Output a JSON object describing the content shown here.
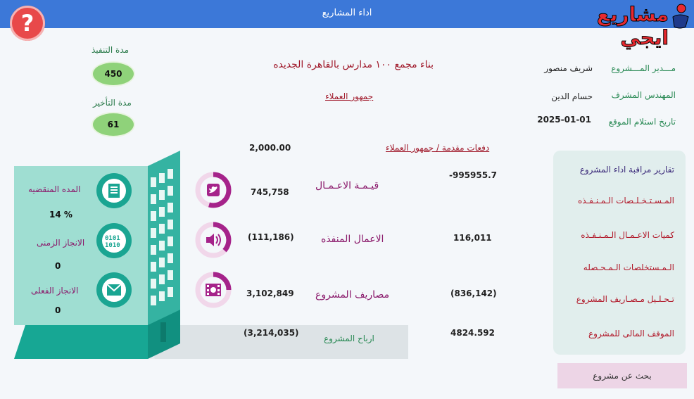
{
  "window": {
    "title": "اداء المشاريع"
  },
  "help_icon": {
    "glyph": "?"
  },
  "logo": {
    "text": "مشاريع ايجي"
  },
  "project": {
    "title": "بناء مجمع ١٠٠ مدارس بالقاهرة الجديده",
    "client_link": "جمهور العملاء",
    "payments_link": "دفعات مقدمة / جمهور العملاء",
    "payments_value": "2,000.00"
  },
  "info": {
    "manager_label": "مـــدير المـــشروع",
    "manager_value": "شريف منصور",
    "engineer_label": "المهندس المشرف",
    "engineer_value": "حسام الدين",
    "site_date_label": "تاريخ استلام الموقع",
    "site_date_value": "2025-01-01"
  },
  "durations": {
    "exec_label": "مدة التنفيذ",
    "exec_value": "450",
    "delay_label": "مدة التأخير",
    "delay_value": "61"
  },
  "metrics": {
    "works_value_label": "قيـمـة الاعـمـال",
    "works_value": "745,758",
    "works_right_value": "-995955.7",
    "executed_label": "الاعمال المنفذه",
    "executed_value": "(111,186)",
    "executed_right_value": "116,011",
    "expenses_label": "مصاريف المشروع",
    "expenses_value": "3,102,849",
    "expenses_right_value": "(836,142)",
    "profit_label": "ارباح المشروع",
    "profit_value": "(3,214,035)",
    "profit_right_value": "4824.592"
  },
  "progress": {
    "elapsed_label": "المده المنقضيه",
    "elapsed_value": "14 %",
    "time_label": "الانجاز الزمنى",
    "time_value": "0",
    "actual_label": "الانجاز الفعلى",
    "actual_value": "0"
  },
  "menu": [
    "تقارير مراقبة اداء المشروع",
    "المـسـتـخـلـصات الـمـنـفـذه",
    "كميات الاعـمـال الـمـنـفـذه",
    "الـمـستخلصات الـمـحـصله",
    "تـحـلـيل مـصـاريف المشروع",
    "الموقف المالى للمشروع"
  ],
  "search_button": "بحث عن مشروع",
  "icons": {
    "document": "document-icon",
    "binary": "binary-icon",
    "mail": "mail-icon",
    "twitter": "twitter-icon",
    "speaker": "speaker-icon",
    "film": "film-icon"
  },
  "colors": {
    "titlebar": "#3c78d8",
    "teal": "#1aa592",
    "purple": "#a5238a",
    "red_text": "#a0192a",
    "green_label": "#2a8a55"
  }
}
